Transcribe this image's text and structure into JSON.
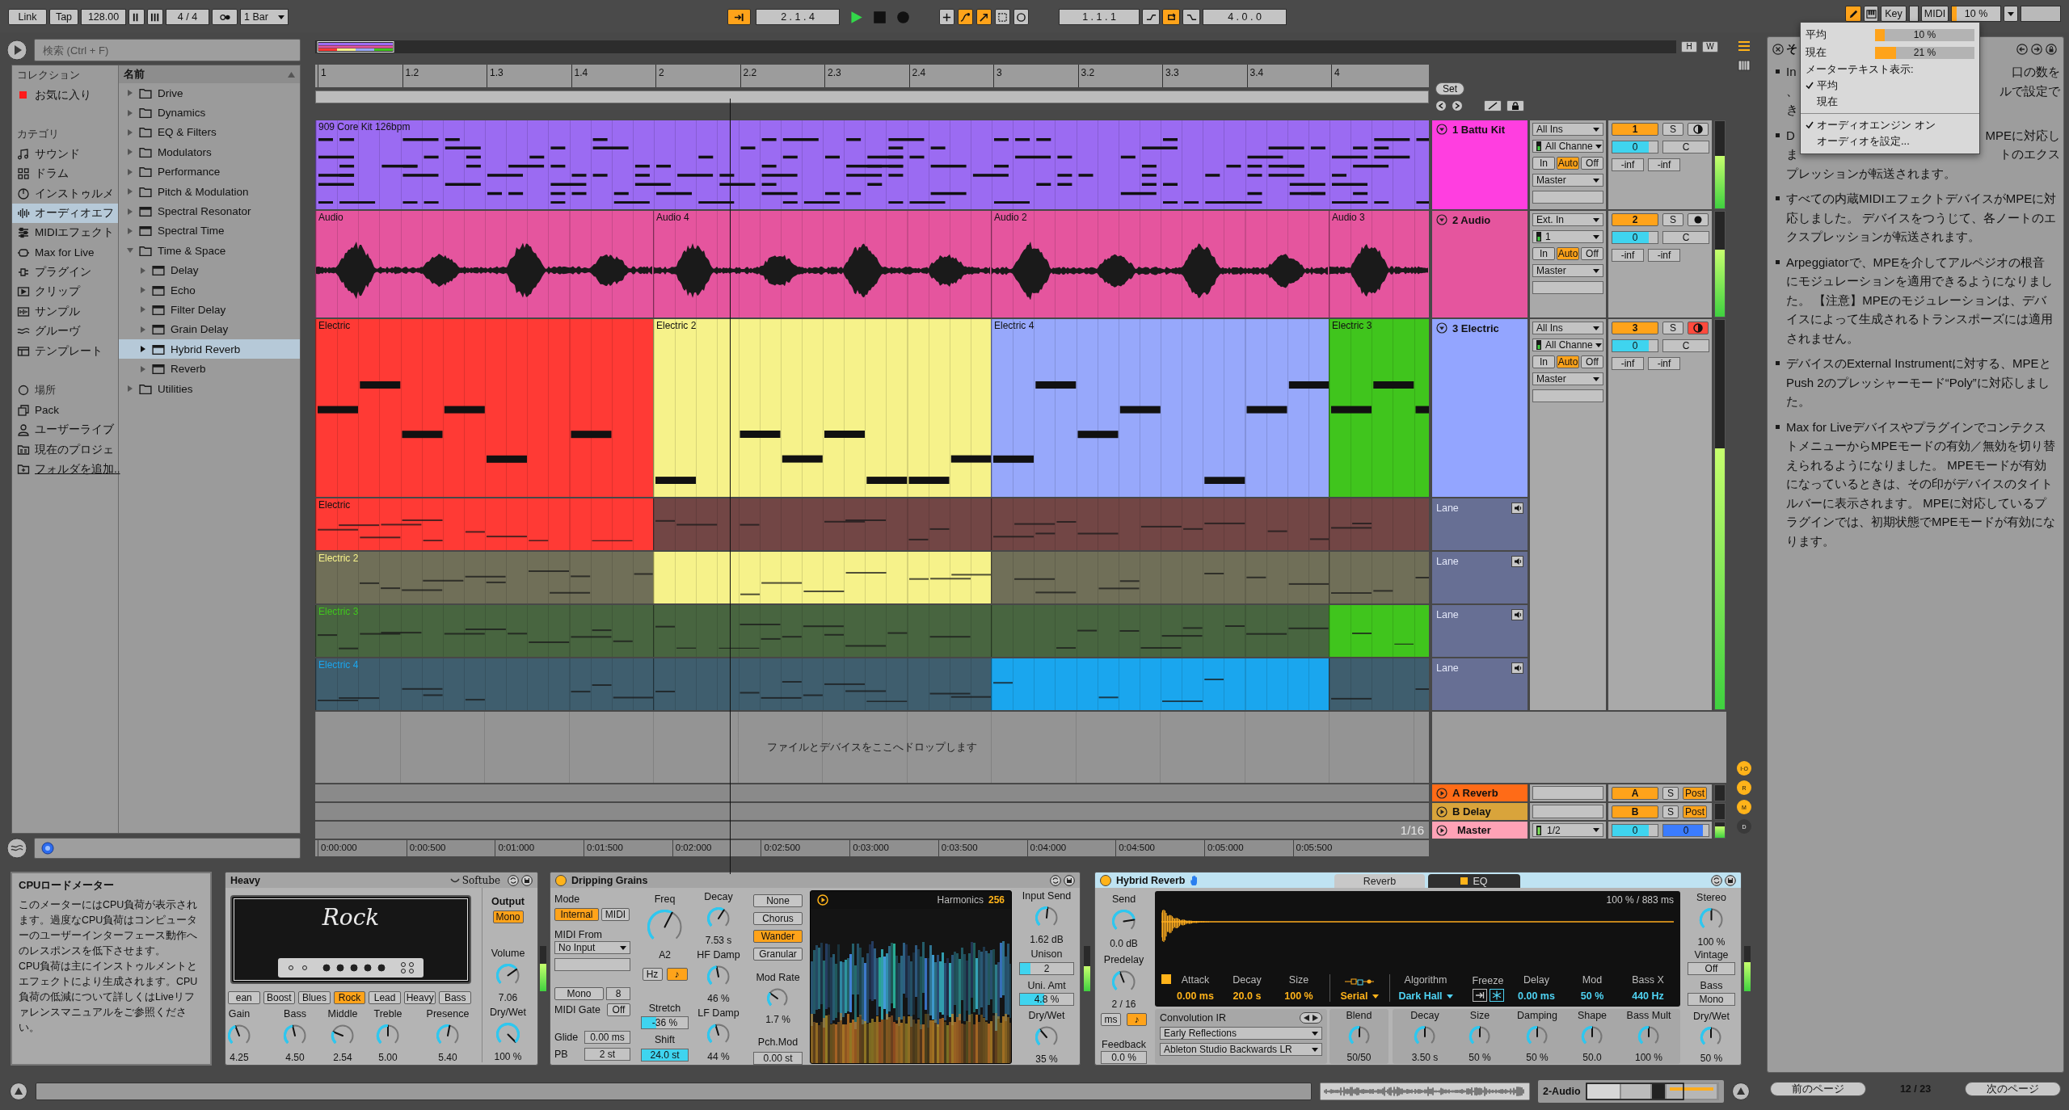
{
  "toolbar": {
    "link": "Link",
    "tap": "Tap",
    "tempo": "128.00",
    "signature": "4 / 4",
    "quantization": "1 Bar",
    "follow": {
      "on": true
    },
    "position": "2 . 1 . 4",
    "transport": [
      {
        "kind": "play",
        "on": true
      },
      {
        "kind": "stop",
        "on": false
      },
      {
        "kind": "record",
        "on": false
      }
    ],
    "record_options": [
      {
        "kind": "overdub",
        "on": false
      },
      {
        "kind": "automation-arm",
        "on": true
      },
      {
        "kind": "re-enable",
        "on": true
      },
      {
        "kind": "capture",
        "on": false
      },
      {
        "kind": "session-record",
        "on": false
      }
    ],
    "loop_start": "1 . 1 . 1",
    "loop_options": [
      {
        "kind": "punch-in",
        "on": false
      },
      {
        "kind": "loop",
        "on": true
      },
      {
        "kind": "punch-out",
        "on": false
      }
    ],
    "loop_length": "4 . 0 . 0",
    "draw_mode": {
      "on": true
    },
    "key": "Key",
    "midi": "MIDI",
    "cpu": {
      "reading": "10 %",
      "level": 0.1
    }
  },
  "cpu_menu": {
    "meters": [
      {
        "label": "平均",
        "reading": "10 %",
        "level": 0.1
      },
      {
        "label": "現在",
        "reading": "21 %",
        "level": 0.21
      }
    ],
    "heading": "メーターテキスト表示:",
    "options": [
      {
        "label": "平均",
        "checked": true
      },
      {
        "label": "現在",
        "checked": false
      }
    ],
    "actions": [
      {
        "label": "オーディオエンジン オン",
        "checked": true
      },
      {
        "label": "オーディオを設定...",
        "checked": false
      }
    ]
  },
  "browser": {
    "search": {
      "placeholder": "検索 (Ctrl + F)"
    },
    "sidebar": [
      {
        "heading": "コレクション",
        "items": [
          {
            "label": "お気に入り",
            "kind": "tag",
            "color": "#ff1a1a",
            "selected": false
          }
        ]
      },
      {
        "heading": "カテゴリ",
        "items": [
          {
            "label": "サウンド",
            "kind": "category",
            "selected": false
          },
          {
            "label": "ドラム",
            "kind": "category",
            "selected": false
          },
          {
            "label": "インストゥルメ",
            "kind": "category",
            "selected": false
          },
          {
            "label": "オーディオエフ",
            "kind": "category",
            "selected": true
          },
          {
            "label": "MIDIエフェクト",
            "kind": "category",
            "selected": false
          },
          {
            "label": "Max for Live",
            "kind": "category",
            "selected": false
          },
          {
            "label": "プラグイン",
            "kind": "category",
            "selected": false
          },
          {
            "label": "クリップ",
            "kind": "category",
            "selected": false
          },
          {
            "label": "サンプル",
            "kind": "category",
            "selected": false
          },
          {
            "label": "グルーヴ",
            "kind": "category",
            "selected": false
          },
          {
            "label": "テンプレート",
            "kind": "category",
            "selected": false
          }
        ]
      },
      {
        "heading": "場所",
        "items": [
          {
            "label": "Pack",
            "kind": "place",
            "selected": false
          },
          {
            "label": "ユーザーライブ",
            "kind": "place",
            "selected": false
          },
          {
            "label": "現在のプロジェ",
            "kind": "place",
            "selected": false
          },
          {
            "label": "フォルダを追加..",
            "kind": "action",
            "selected": false
          }
        ]
      }
    ],
    "list": {
      "header": "名前",
      "items": [
        {
          "label": "Drive",
          "kind": "folder",
          "expanded": false,
          "selected": false
        },
        {
          "label": "Dynamics",
          "kind": "folder",
          "expanded": false,
          "selected": false
        },
        {
          "label": "EQ & Filters",
          "kind": "folder",
          "expanded": false,
          "selected": false
        },
        {
          "label": "Modulators",
          "kind": "folder",
          "expanded": false,
          "selected": false
        },
        {
          "label": "Performance",
          "kind": "folder",
          "expanded": false,
          "selected": false
        },
        {
          "label": "Pitch & Modulation",
          "kind": "folder",
          "expanded": false,
          "selected": false
        },
        {
          "label": "Spectral Resonator",
          "kind": "device",
          "expanded": false,
          "selected": false
        },
        {
          "label": "Spectral Time",
          "kind": "device",
          "expanded": false,
          "selected": false
        },
        {
          "label": "Time & Space",
          "kind": "folder",
          "expanded": true,
          "selected": false,
          "children": [
            {
              "label": "Delay",
              "kind": "device",
              "expanded": false,
              "selected": false
            },
            {
              "label": "Echo",
              "kind": "device",
              "expanded": false,
              "selected": false
            },
            {
              "label": "Filter Delay",
              "kind": "device",
              "expanded": false,
              "selected": false
            },
            {
              "label": "Grain Delay",
              "kind": "device",
              "expanded": false,
              "selected": false
            },
            {
              "label": "Hybrid Reverb",
              "kind": "device",
              "expanded": false,
              "selected": true
            },
            {
              "label": "Reverb",
              "kind": "device",
              "expanded": false,
              "selected": false
            }
          ]
        },
        {
          "label": "Utilities",
          "kind": "folder",
          "expanded": false,
          "selected": false
        }
      ]
    }
  },
  "arrangement": {
    "overview_buttons": [
      "H",
      "W"
    ],
    "ruler": [
      "1",
      "1.2",
      "1.3",
      "1.4",
      "2",
      "2.2",
      "2.3",
      "2.4",
      "3",
      "3.2",
      "3.3",
      "3.4",
      "4"
    ],
    "set": "Set",
    "tracks": [
      {
        "kind": "midi",
        "name": "1 Battu Kit",
        "color": "#ff3ee0",
        "clips": [
          {
            "name": "909 Core Kit 126bpm",
            "color": "#9b6bf2"
          }
        ],
        "input": "All Ins",
        "channel": "All Channe",
        "monitor": [
          {
            "label": "In",
            "selected": false
          },
          {
            "label": "Auto",
            "selected": true
          },
          {
            "label": "Off",
            "selected": false
          }
        ],
        "output": "Master",
        "number": "1",
        "active": true,
        "solo": {
          "label": "S",
          "on": false
        },
        "arm": {
          "on": false
        },
        "volume": {
          "value": "0",
          "level": 0.8
        },
        "pan": "C",
        "peaks": [
          "-inf",
          "-inf"
        ],
        "meter": {
          "level": 0.6
        }
      },
      {
        "kind": "audio",
        "name": "2 Audio",
        "color": "#e5559e",
        "clips": [
          {
            "name": "Audio",
            "color": "#e5559e"
          },
          {
            "name": "Audio 4",
            "color": "#e5559e"
          },
          {
            "name": "Audio 2",
            "color": "#e5559e"
          },
          {
            "name": "Audio 3",
            "color": "#e5559e"
          }
        ],
        "input": "Ext. In",
        "channel": "1",
        "monitor": [
          {
            "label": "In",
            "selected": false
          },
          {
            "label": "Auto",
            "selected": true
          },
          {
            "label": "Off",
            "selected": false
          }
        ],
        "output": "Master",
        "number": "2",
        "active": true,
        "solo": {
          "label": "S",
          "on": false
        },
        "arm": {
          "on": false
        },
        "volume": {
          "value": "0",
          "level": 0.8
        },
        "pan": "C",
        "peaks": [
          "-inf",
          "-inf"
        ],
        "meter": {
          "level": 0.64
        }
      },
      {
        "kind": "midi",
        "name": "3 Electric",
        "color": "#93a5ff",
        "clips": [
          {
            "name": "Electric",
            "color": "#ff3a35"
          },
          {
            "name": "Electric 2",
            "color": "#f6f28a"
          },
          {
            "name": "Electric 4",
            "color": "#97a8fb"
          },
          {
            "name": "Electric 3",
            "color": "#40c51d"
          }
        ],
        "input": "All Ins",
        "channel": "All Channe",
        "monitor": [
          {
            "label": "In",
            "selected": false
          },
          {
            "label": "Auto",
            "selected": true
          },
          {
            "label": "Off",
            "selected": false
          }
        ],
        "output": "Master",
        "number": "3",
        "active": true,
        "solo": {
          "label": "S",
          "on": false
        },
        "arm": {
          "on": true
        },
        "volume": {
          "value": "0",
          "level": 0.8
        },
        "pan": "C",
        "peaks": [
          "-inf",
          "-inf"
        ],
        "meter": {
          "level": 0.67
        },
        "lanes": [
          {
            "name": "Lane",
            "take": "Electric",
            "color": "#ff3a35",
            "segments": [
              {
                "active": true
              },
              {
                "active": false
              },
              {
                "active": false
              },
              {
                "active": false
              }
            ]
          },
          {
            "name": "Lane",
            "take": "Electric 2",
            "color": "#f6f28a",
            "segments": [
              {
                "active": false
              },
              {
                "active": true
              },
              {
                "active": false
              },
              {
                "active": false
              }
            ]
          },
          {
            "name": "Lane",
            "take": "Electric 3",
            "color": "#40c51d",
            "segments": [
              {
                "active": false
              },
              {
                "active": false
              },
              {
                "active": false
              },
              {
                "active": true
              }
            ]
          },
          {
            "name": "Lane",
            "take": "Electric 4",
            "color": "#1aa6ee",
            "segments": [
              {
                "active": false
              },
              {
                "active": false
              },
              {
                "active": true
              },
              {
                "active": false
              }
            ]
          }
        ]
      }
    ],
    "drop_hint": "ファイルとデバイスをここへドロップします",
    "returns": [
      {
        "name": "A Reverb",
        "color": "#ff6b17",
        "send": "A",
        "active": true,
        "solo": {
          "label": "S",
          "on": false
        },
        "post": {
          "label": "Post",
          "on": true
        }
      },
      {
        "name": "B Delay",
        "color": "#d9a43b",
        "send": "B",
        "active": true,
        "solo": {
          "label": "S",
          "on": false
        },
        "post": {
          "label": "Post",
          "on": true
        }
      }
    ],
    "master": {
      "name": "Master",
      "color": "#ffa2b6",
      "output": "1/2",
      "volume": {
        "value": "0",
        "level": 0.8
      },
      "cue": {
        "value": "0",
        "level": 0.88
      },
      "meter": {
        "level": 0.75
      }
    },
    "grid": "1/16",
    "time_ruler": [
      "0:00:000",
      "0:00:500",
      "0:01:000",
      "0:01:500",
      "0:02:000",
      "0:02:500",
      "0:03:000",
      "0:03:500",
      "0:04:000",
      "0:04:500",
      "0:05:000",
      "0:05:500"
    ],
    "view_toggles": [
      {
        "label": "I·O",
        "on": true
      },
      {
        "label": "R",
        "on": true
      },
      {
        "label": "M",
        "on": true
      },
      {
        "label": "D",
        "on": false
      }
    ]
  },
  "info": {
    "title": "CPUロードメーター",
    "paragraphs": [
      "このメーターにはCPU負荷が表示されます。過度なCPU負荷はコンピューターのユーザーインターフェース動作へのレスポンスを低下させます。",
      "CPU負荷は主にインストゥルメントとエフェクトにより生成されます。CPU負荷の低減について詳しくはLiveリファレンスマニュアルをご参照ください。"
    ]
  },
  "devices": [
    {
      "kind": "amp",
      "title": "Heavy",
      "brand": "Softube",
      "selected": false,
      "model": "Rock",
      "presets": [
        {
          "label": "ean",
          "selected": false
        },
        {
          "label": "Boost",
          "selected": false
        },
        {
          "label": "Blues",
          "selected": false
        },
        {
          "label": "Rock",
          "selected": true
        },
        {
          "label": "Lead",
          "selected": false
        },
        {
          "label": "Heavy",
          "selected": false
        },
        {
          "label": "Bass",
          "selected": false
        }
      ],
      "knobs": [
        {
          "label": "Gain",
          "value": "4.25",
          "level": 0.42
        },
        {
          "label": "Bass",
          "value": "4.50",
          "level": 0.45
        },
        {
          "label": "Middle",
          "value": "2.54",
          "level": 0.25
        },
        {
          "label": "Treble",
          "value": "5.00",
          "level": 0.5
        },
        {
          "label": "Presence",
          "value": "5.40",
          "level": 0.54
        }
      ],
      "output": {
        "title": "Output",
        "mono": {
          "label": "Mono",
          "on": true
        },
        "volume": {
          "label": "Volume",
          "value": "7.06",
          "level": 0.7
        },
        "dry_wet": {
          "label": "Dry/Wet",
          "value": "100 %",
          "level": 1
        }
      },
      "meter": {
        "level": 0.6
      }
    },
    {
      "kind": "grains",
      "title": "Dripping Grains",
      "on": true,
      "selected": false,
      "mode": {
        "label": "Mode",
        "options": [
          {
            "label": "Internal",
            "selected": true
          },
          {
            "label": "MIDI",
            "selected": false
          }
        ]
      },
      "midi_from": {
        "label": "MIDI From",
        "value": "No Input"
      },
      "mono": {
        "label": "Mono",
        "on": false
      },
      "voices": "8",
      "midi_gate": {
        "label": "MIDI Gate",
        "value": "Off"
      },
      "glide": {
        "label": "Glide",
        "value": "0.00 ms"
      },
      "pitch_bend": {
        "label": "PB",
        "value": "2 st"
      },
      "freq": {
        "label": "Freq",
        "value": "A2",
        "level": 0.6
      },
      "freq_units": [
        {
          "label": "Hz",
          "selected": false
        },
        {
          "label": "♪",
          "selected": true
        }
      ],
      "stretch": {
        "label": "Stretch",
        "value": "-36 %",
        "level": 0.32
      },
      "shift": {
        "label": "Shift",
        "value": "24.0 st",
        "level": 1
      },
      "decay": {
        "label": "Decay",
        "value": "7.53 s",
        "level": 0.62
      },
      "hf_damp": {
        "label": "HF Damp",
        "value": "46 %",
        "level": 0.46
      },
      "lf_damp": {
        "label": "LF Damp",
        "value": "44 %",
        "level": 0.44
      },
      "mod_types": [
        {
          "label": "None",
          "selected": false
        },
        {
          "label": "Chorus",
          "selected": false
        },
        {
          "label": "Wander",
          "selected": true
        },
        {
          "label": "Granular",
          "selected": false
        }
      ],
      "mod_rate": {
        "label": "Mod Rate",
        "value": "1.7 %",
        "level": 0.3
      },
      "pitch_mod": {
        "label": "Pch.Mod",
        "value": "0.00 st"
      },
      "display": {
        "label": "Harmonics",
        "value": "256"
      },
      "input_send": {
        "label": "Input Send",
        "value": "1.62 dB",
        "level": 0.52
      },
      "unison": {
        "label": "Unison",
        "value": "2",
        "level": 0.2
      },
      "unison_amount": {
        "label": "Uni. Amt",
        "value": "4.8 %",
        "level": 0.45
      },
      "dry_wet": {
        "label": "Dry/Wet",
        "value": "35 %",
        "level": 0.35
      },
      "meter": {
        "level": 0.55
      }
    },
    {
      "kind": "reverb",
      "title": "Hybrid Reverb",
      "on": true,
      "selected": true,
      "tabs": [
        {
          "label": "Reverb",
          "selected": true
        },
        {
          "label": "EQ",
          "selected": false,
          "on": true
        }
      ],
      "send": {
        "label": "Send",
        "value": "0.0 dB",
        "level": 0.8
      },
      "predelay": {
        "label": "Predelay",
        "value": "2 / 16",
        "level": 0.42
      },
      "predelay_units": [
        {
          "label": "ms",
          "selected": false
        },
        {
          "label": "♪",
          "selected": true
        }
      ],
      "feedback": {
        "label": "Feedback",
        "value": "0.0 %"
      },
      "reading": "100 % / 883 ms",
      "convolution": {
        "on": true,
        "params": [
          {
            "label": "Attack",
            "value": "0.00 ms"
          },
          {
            "label": "Decay",
            "value": "20.0 s"
          },
          {
            "label": "Size",
            "value": "100 %"
          }
        ]
      },
      "routing": "Serial",
      "algorithm": {
        "label": "Algorithm",
        "value": "Dark Hall"
      },
      "freeze": {
        "label": "Freeze"
      },
      "algorithm_params": [
        {
          "label": "Delay",
          "value": "0.00 ms"
        },
        {
          "label": "Mod",
          "value": "50 %"
        },
        {
          "label": "Bass X",
          "value": "440 Hz"
        }
      ],
      "ir": {
        "label": "Convolution IR",
        "category": "Early Reflections",
        "file": "Ableton Studio Backwards LR"
      },
      "blend": {
        "label": "Blend",
        "value": "50/50",
        "level": 0.5
      },
      "knobs": [
        {
          "label": "Decay",
          "value": "3.50 s",
          "level": 0.5
        },
        {
          "label": "Size",
          "value": "50 %",
          "level": 0.5
        },
        {
          "label": "Damping",
          "value": "50 %",
          "level": 0.5
        },
        {
          "label": "Shape",
          "value": "50.0",
          "level": 0.5
        },
        {
          "label": "Bass Mult",
          "value": "100 %",
          "level": 0.5
        }
      ],
      "stereo": {
        "label": "Stereo",
        "value": "100 %",
        "level": 0.5
      },
      "vintage": {
        "label": "Vintage",
        "value": "Off"
      },
      "bass": {
        "label": "Bass",
        "value": "Mono"
      },
      "dry_wet": {
        "label": "Dry/Wet",
        "value": "50 %",
        "level": 0.5
      },
      "meter": {
        "level": 0.65
      }
    }
  ],
  "status_bar": {
    "track": "2-Audio"
  },
  "help": {
    "title": "そ",
    "bullets": [
      {
        "kind": "fragments",
        "lines": [
          {
            "left": "In",
            "right": "口の数を"
          },
          {
            "left": "、",
            "right": "ルで設定で"
          },
          {
            "left": "き"
          }
        ]
      },
      {
        "kind": "fragments",
        "lines": [
          {
            "left": "D",
            "right": "MPEに対応し"
          },
          {
            "left": "ま",
            "right": "トのエクス"
          },
          {
            "left": "プレッションが転送されます。"
          }
        ]
      },
      {
        "kind": "text",
        "text": "すべての内蔵MIDIエフェクトデバイスがMPEに対応しました。 デバイスをつうじて、各ノートのエクスプレッションが転送されます。"
      },
      {
        "kind": "text",
        "text": "Arpeggiatorで、MPEを介してアルペジオの根音にモジュレーションを適用できるようになりました。 【注意】MPEのモジュレーションは、デバイスによって生成されるトランスポーズには適用されません。"
      },
      {
        "kind": "text",
        "text": "デバイスのExternal Instrumentに対する、MPEとPush 2のプレッシャーモード“Poly”に対応しました。"
      },
      {
        "kind": "text",
        "text": "Max for LiveデバイスやプラグインでコンテクストメニューからMPEモードの有効／無効を切り替えられるようになりました。 MPEモードが有効になっているときは、その印がデバイスのタイトルバーに表示されます。 MPEに対応しているプラグインでは、初期状態でMPEモードが有効になります。"
      }
    ],
    "pager": {
      "previous": "前のページ",
      "page": "12 / 23",
      "next": "次のページ"
    }
  }
}
